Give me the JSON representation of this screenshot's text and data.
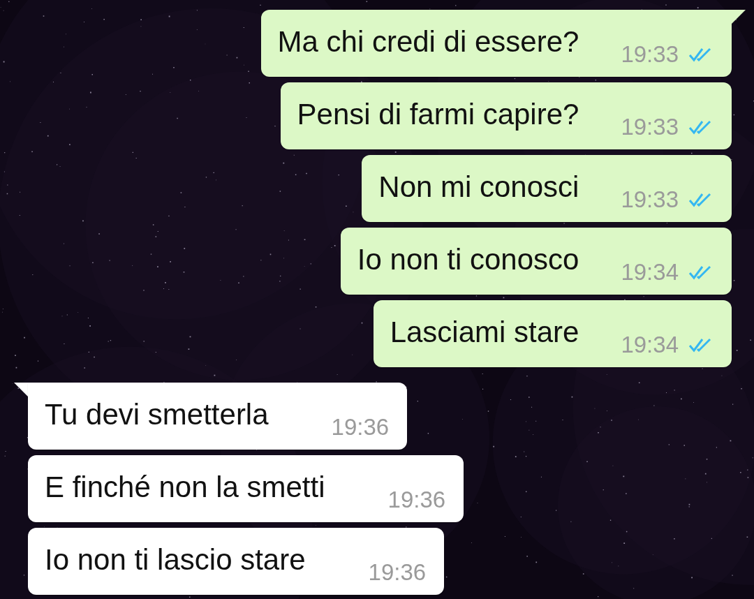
{
  "messages": [
    {
      "kind": "outgoing",
      "tail": true,
      "text": "Ma chi credi di essere?",
      "time": "19:33",
      "read": true
    },
    {
      "kind": "outgoing",
      "tail": false,
      "text": "Pensi di farmi capire?",
      "time": "19:33",
      "read": true
    },
    {
      "kind": "outgoing",
      "tail": false,
      "text": "Non mi conosci",
      "time": "19:33",
      "read": true
    },
    {
      "kind": "outgoing",
      "tail": false,
      "text": "Io non ti conosco",
      "time": "19:34",
      "read": true
    },
    {
      "kind": "outgoing",
      "tail": false,
      "text": "Lasciami stare",
      "time": "19:34",
      "read": true
    },
    {
      "kind": "incoming",
      "tail": true,
      "text": "Tu devi smetterla",
      "time": "19:36"
    },
    {
      "kind": "incoming",
      "tail": false,
      "text": "E finché non la smetti",
      "time": "19:36"
    },
    {
      "kind": "incoming",
      "tail": false,
      "text": "Io non ti lascio stare",
      "time": "19:36"
    }
  ]
}
